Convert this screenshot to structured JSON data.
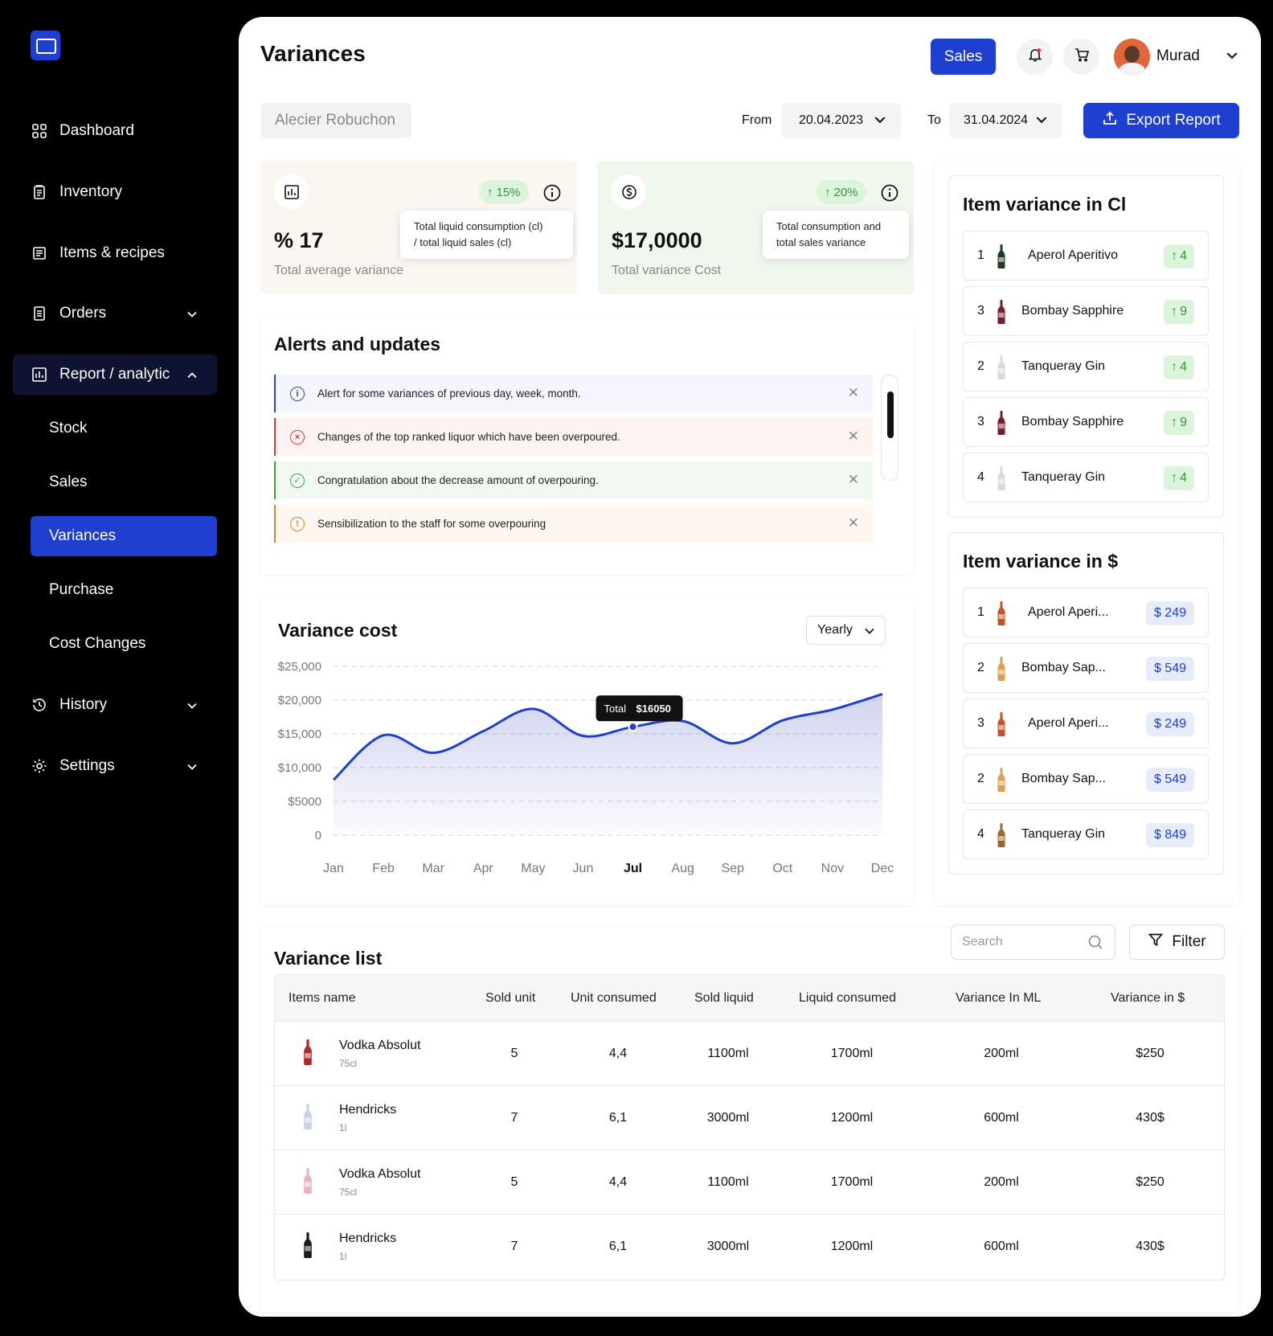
{
  "sidebar": {
    "nav": [
      {
        "label": "Dashboard",
        "icon": "grid-icon"
      },
      {
        "label": "Inventory",
        "icon": "clipboard-icon"
      },
      {
        "label": "Items & recipes",
        "icon": "receipt-icon"
      },
      {
        "label": "Orders",
        "icon": "document-icon"
      },
      {
        "label": "Report / analytic",
        "icon": "chart-icon"
      },
      {
        "label": "History",
        "icon": "history-icon"
      },
      {
        "label": "Settings",
        "icon": "gear-icon"
      }
    ],
    "sub": [
      "Stock",
      "Sales",
      "Variances",
      "Purchase",
      "Cost Changes"
    ]
  },
  "header": {
    "title": "Variances",
    "sales_label": "Sales",
    "user_name": "Murad"
  },
  "filters": {
    "restaurant": "Alecier Robuchon",
    "from_label": "From",
    "from_date": "20.04.2023",
    "to_label": "To",
    "to_date": "31.04.2024",
    "export_label": "Export Report"
  },
  "stats": [
    {
      "value": "% 17",
      "label": "Total average variance",
      "change": "15%",
      "tooltip_l1": "Total liquid consumption (cl)",
      "tooltip_l2": "/ total liquid sales (cl)"
    },
    {
      "value": "$17,0000",
      "label": "Total variance Cost",
      "change": "20%",
      "tooltip_l1": "Total consumption and",
      "tooltip_l2": "total sales variance"
    }
  ],
  "alerts": {
    "title": "Alerts and updates",
    "items": [
      {
        "text": "Alert for some variances of previous day, week, month.",
        "type": "info",
        "color": "#2f46c8"
      },
      {
        "text": "Changes of the top ranked liquor which have been overpoured.",
        "type": "error",
        "color": "#d93a3a"
      },
      {
        "text": "Congratulation about the decrease amount of overpouring.",
        "type": "success",
        "color": "#3aa845"
      },
      {
        "text": "Sensibilization to the staff for some overpouring",
        "type": "warning",
        "color": "#d4873a"
      }
    ]
  },
  "chart": {
    "title": "Variance cost",
    "period": "Yearly",
    "tooltip_label": "Total",
    "tooltip_value": "$16050",
    "y_ticks": [
      "$25,000",
      "$20,000",
      "$15,000",
      "$10,000",
      "$5000",
      "0"
    ],
    "active_month": "Jul"
  },
  "chart_data": {
    "type": "area",
    "title": "Variance cost",
    "x": [
      "Jan",
      "Feb",
      "Mar",
      "Apr",
      "May",
      "Jun",
      "Jul",
      "Aug",
      "Sep",
      "Oct",
      "Nov",
      "Dec"
    ],
    "values": [
      8200,
      14800,
      12200,
      15400,
      18700,
      14700,
      16050,
      16900,
      13600,
      17000,
      18600,
      20900
    ],
    "ylim": [
      0,
      25000
    ],
    "grid": true,
    "color": "#1e3fd0"
  },
  "variance_cl": {
    "title": "Item variance in Cl",
    "items": [
      {
        "rank": "1",
        "name": "Aperol Aperitivo",
        "change": "4",
        "bottle": "#1f3b24"
      },
      {
        "rank": "3",
        "name": "Bombay Sapphire",
        "change": "9",
        "bottle": "#7a1c2a"
      },
      {
        "rank": "2",
        "name": "Tanqueray Gin",
        "change": "4",
        "bottle": "#d8dadc"
      },
      {
        "rank": "3",
        "name": "Bombay Sapphire",
        "change": "9",
        "bottle": "#7a1c2a"
      },
      {
        "rank": "4",
        "name": "Tanqueray Gin",
        "change": "4",
        "bottle": "#d8dadc"
      }
    ]
  },
  "variance_usd": {
    "title": "Item variance in $",
    "items": [
      {
        "rank": "1",
        "name": "Aperol Aperi...",
        "price": "$ 249",
        "bottle": "#c4532a"
      },
      {
        "rank": "2",
        "name": "Bombay Sap...",
        "price": "$ 549",
        "bottle": "#d8a050"
      },
      {
        "rank": "3",
        "name": "Aperol Aperi...",
        "price": "$ 249",
        "bottle": "#c4532a"
      },
      {
        "rank": "2",
        "name": "Bombay Sap...",
        "price": "$ 549",
        "bottle": "#d8a050"
      },
      {
        "rank": "4",
        "name": "Tanqueray Gin",
        "price": "$ 849",
        "bottle": "#9a6a2a"
      }
    ]
  },
  "variance_list": {
    "title": "Variance list",
    "search_placeholder": "Search",
    "filter_label": "Filter",
    "columns": [
      "Items name",
      "Sold unit",
      "Unit consumed",
      "Sold liquid",
      "Liquid consumed",
      "Variance In ML",
      "Variance in $"
    ],
    "rows": [
      {
        "name": "Vodka Absolut",
        "size": "75cl",
        "sold_unit": "5",
        "unit_consumed": "4,4",
        "sold_liquid": "1100ml",
        "liquid_consumed": "1700ml",
        "variance_ml": "200ml",
        "variance_usd": "$250",
        "bottle": "#b3262a"
      },
      {
        "name": "Hendricks",
        "size": "1l",
        "sold_unit": "7",
        "unit_consumed": "6,1",
        "sold_liquid": "3000ml",
        "liquid_consumed": "1200ml",
        "variance_ml": "600ml",
        "variance_usd": "430$",
        "bottle": "#c8d4e4"
      },
      {
        "name": "Vodka Absolut",
        "size": "75cl",
        "sold_unit": "5",
        "unit_consumed": "4,4",
        "sold_liquid": "1100ml",
        "liquid_consumed": "1700ml",
        "variance_ml": "200ml",
        "variance_usd": "$250",
        "bottle": "#e8b4bc"
      },
      {
        "name": "Hendricks",
        "size": "1l",
        "sold_unit": "7",
        "unit_consumed": "6,1",
        "sold_liquid": "3000ml",
        "liquid_consumed": "1200ml",
        "variance_ml": "600ml",
        "variance_usd": "430$",
        "bottle": "#1a1a1a"
      }
    ]
  }
}
